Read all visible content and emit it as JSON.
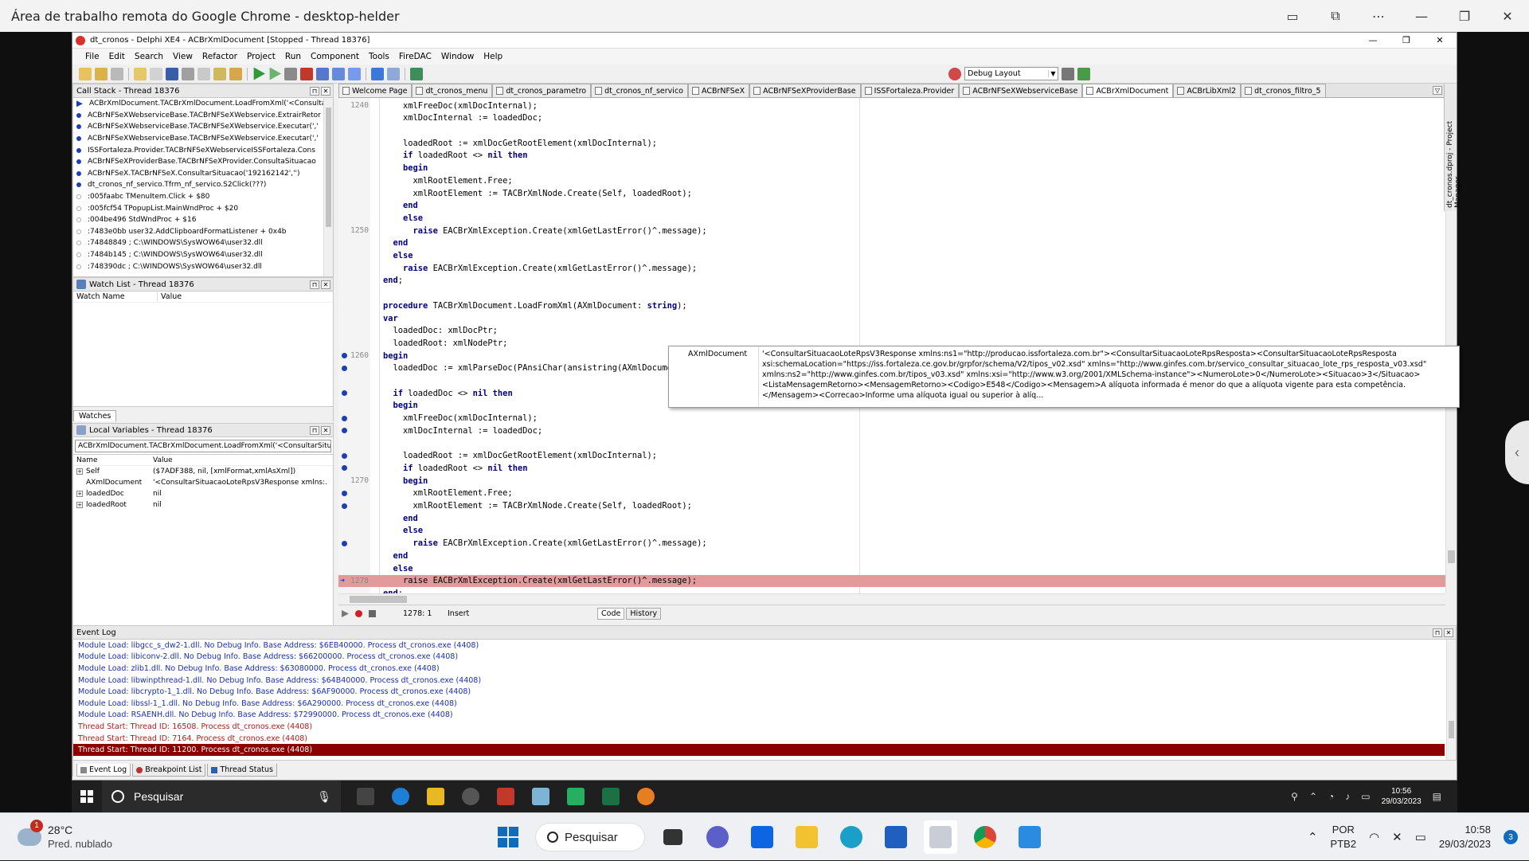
{
  "outer_window": {
    "title": "Área de trabalho remota do Google Chrome - desktop-helder",
    "controls": [
      "▭",
      "⧉",
      "⋯",
      "—",
      "❐",
      "✕"
    ]
  },
  "ide": {
    "title": "dt_cronos - Delphi XE4 - ACBrXmlDocument [Stopped - Thread 18376]",
    "menu": [
      "File",
      "Edit",
      "Search",
      "View",
      "Refactor",
      "Project",
      "Run",
      "Component",
      "Tools",
      "FireDAC",
      "Window",
      "Help"
    ],
    "layout_select": "Debug Layout",
    "colors": {
      "accent": "#1d3fb0",
      "execution_line": "#e39a9a",
      "selected_log": "#8b0000"
    }
  },
  "call_stack": {
    "title": "Call Stack - Thread 18376",
    "rows": [
      {
        "text": "ACBrXmlDocument.TACBrXmlDocument.LoadFromXml('<ConsultarS",
        "marker": "arrow"
      },
      {
        "text": "ACBrNFSeXWebserviceBase.TACBrNFSeXWebservice.ExtrairRetor",
        "marker": "blue"
      },
      {
        "text": "ACBrNFSeXWebserviceBase.TACBrNFSeXWebservice.Executar(','",
        "marker": "blue"
      },
      {
        "text": "ACBrNFSeXWebserviceBase.TACBrNFSeXWebservice.Executar(','",
        "marker": "blue"
      },
      {
        "text": "ISSFortaleza.Provider.TACBrNFSeXWebserviceISSFortaleza.Cons",
        "marker": "blue"
      },
      {
        "text": "ACBrNFSeXProviderBase.TACBrNFSeXProvider.ConsultaSituacao",
        "marker": "blue"
      },
      {
        "text": "ACBrNFSeX.TACBrNFSeX.ConsultarSituacao('192162142','')",
        "marker": "blue"
      },
      {
        "text": "dt_cronos_nf_servico.Tfrm_nf_servico.S2Click(???)",
        "marker": "blue"
      },
      {
        "text": ":005faabc TMenuItem.Click + $80",
        "marker": "grey"
      },
      {
        "text": ":005fcf54 TPopupList.MainWndProc + $20",
        "marker": "grey"
      },
      {
        "text": ":004be496 StdWndProc + $16",
        "marker": "grey"
      },
      {
        "text": ":7483e0bb user32.AddClipboardFormatListener + 0x4b",
        "marker": "grey"
      },
      {
        "text": ":74848849 ; C:\\WINDOWS\\SysWOW64\\user32.dll",
        "marker": "grey"
      },
      {
        "text": ":7484b145 ; C:\\WINDOWS\\SysWOW64\\user32.dll",
        "marker": "grey"
      },
      {
        "text": ":748390dc ; C:\\WINDOWS\\SysWOW64\\user32.dll",
        "marker": "grey"
      }
    ]
  },
  "watch_list": {
    "title": "Watch List - Thread 18376",
    "col_name": "Watch Name",
    "col_value": "Value",
    "tab": "Watches"
  },
  "local_variables": {
    "title": "Local Variables - Thread 18376",
    "scope": "ACBrXmlDocument.TACBrXmlDocument.LoadFromXml('<ConsultarSitu",
    "col_name": "Name",
    "col_value": "Value",
    "rows": [
      {
        "name": "Self",
        "value": "($7ADF388, nil, [xmlFormat,xmlAsXml])",
        "expand": "+"
      },
      {
        "name": "AXmlDocument",
        "value": "'<ConsultarSituacaoLoteRpsV3Response xmlns:...",
        "expand": ""
      },
      {
        "name": "loadedDoc",
        "value": "nil",
        "expand": "+"
      },
      {
        "name": "loadedRoot",
        "value": "nil",
        "expand": "+"
      }
    ]
  },
  "editor_tabs": [
    {
      "label": "Welcome Page",
      "active": false
    },
    {
      "label": "dt_cronos_menu",
      "active": false
    },
    {
      "label": "dt_cronos_parametro",
      "active": false
    },
    {
      "label": "dt_cronos_nf_servico",
      "active": false
    },
    {
      "label": "ACBrNFSeX",
      "active": false
    },
    {
      "label": "ACBrNFSeXProviderBase",
      "active": false
    },
    {
      "label": "ISSFortaleza.Provider",
      "active": false
    },
    {
      "label": "ACBrNFSeXWebserviceBase",
      "active": false
    },
    {
      "label": "ACBrXmlDocument",
      "active": true
    },
    {
      "label": "ACBrLibXml2",
      "active": false
    },
    {
      "label": "dt_cronos_filtro_5",
      "active": false
    }
  ],
  "code_lines": [
    {
      "num": "1240",
      "text": "    xmlFreeDoc(xmlDocInternal);",
      "bp": false,
      "exec": false
    },
    {
      "num": "",
      "text": "    xmlDocInternal := loadedDoc;",
      "bp": false,
      "exec": false
    },
    {
      "num": "",
      "text": "",
      "bp": false,
      "exec": false
    },
    {
      "num": "",
      "text": "    loadedRoot := xmlDocGetRootElement(xmlDocInternal);",
      "bp": false,
      "exec": false
    },
    {
      "num": "",
      "text": "    if loadedRoot <> nil then",
      "bp": false,
      "exec": false
    },
    {
      "num": "",
      "text": "    begin",
      "bp": false,
      "exec": false
    },
    {
      "num": "",
      "text": "      xmlRootElement.Free;",
      "bp": false,
      "exec": false
    },
    {
      "num": "",
      "text": "      xmlRootElement := TACBrXmlNode.Create(Self, loadedRoot);",
      "bp": false,
      "exec": false
    },
    {
      "num": "",
      "text": "    end",
      "bp": false,
      "exec": false
    },
    {
      "num": "",
      "text": "    else",
      "bp": false,
      "exec": false
    },
    {
      "num": "1250",
      "text": "      raise EACBrXmlException.Create(xmlGetLastError()^.message);",
      "bp": false,
      "exec": false
    },
    {
      "num": "",
      "text": "  end",
      "bp": false,
      "exec": false
    },
    {
      "num": "",
      "text": "  else",
      "bp": false,
      "exec": false
    },
    {
      "num": "",
      "text": "    raise EACBrXmlException.Create(xmlGetLastError()^.message);",
      "bp": false,
      "exec": false
    },
    {
      "num": "",
      "text": "end;",
      "bp": false,
      "exec": false
    },
    {
      "num": "",
      "text": "",
      "bp": false,
      "exec": false
    },
    {
      "num": "",
      "text": "procedure TACBrXmlDocument.LoadFromXml(AXmlDocument: string);",
      "bp": false,
      "exec": false
    },
    {
      "num": "",
      "text": "var",
      "bp": false,
      "exec": false
    },
    {
      "num": "",
      "text": "  loadedDoc: xmlDocPtr;",
      "bp": false,
      "exec": false
    },
    {
      "num": "",
      "text": "  loadedRoot: xmlNodePtr;",
      "bp": false,
      "exec": false
    },
    {
      "num": "1260",
      "text": "begin",
      "bp": true,
      "exec": false
    },
    {
      "num": "",
      "text": "  loadedDoc := xmlParseDoc(PAnsiChar(ansistring(AXmlDocument)));",
      "bp": true,
      "exec": false
    },
    {
      "num": "",
      "text": "",
      "bp": false,
      "exec": false
    },
    {
      "num": "",
      "text": "  if loadedDoc <> nil then",
      "bp": true,
      "exec": false
    },
    {
      "num": "",
      "text": "  begin",
      "bp": false,
      "exec": false
    },
    {
      "num": "",
      "text": "    xmlFreeDoc(xmlDocInternal);",
      "bp": true,
      "exec": false
    },
    {
      "num": "",
      "text": "    xmlDocInternal := loadedDoc;",
      "bp": true,
      "exec": false
    },
    {
      "num": "",
      "text": "",
      "bp": false,
      "exec": false
    },
    {
      "num": "",
      "text": "    loadedRoot := xmlDocGetRootElement(xmlDocInternal);",
      "bp": true,
      "exec": false
    },
    {
      "num": "",
      "text": "    if loadedRoot <> nil then",
      "bp": true,
      "exec": false
    },
    {
      "num": "1270",
      "text": "    begin",
      "bp": false,
      "exec": false
    },
    {
      "num": "",
      "text": "      xmlRootElement.Free;",
      "bp": true,
      "exec": false
    },
    {
      "num": "",
      "text": "      xmlRootElement := TACBrXmlNode.Create(Self, loadedRoot);",
      "bp": true,
      "exec": false
    },
    {
      "num": "",
      "text": "    end",
      "bp": false,
      "exec": false
    },
    {
      "num": "",
      "text": "    else",
      "bp": false,
      "exec": false
    },
    {
      "num": "",
      "text": "      raise EACBrXmlException.Create(xmlGetLastError()^.message);",
      "bp": true,
      "exec": false
    },
    {
      "num": "",
      "text": "  end",
      "bp": false,
      "exec": false
    },
    {
      "num": "",
      "text": "  else",
      "bp": false,
      "exec": false
    },
    {
      "num": "1278",
      "text": "    raise EACBrXmlException.Create(xmlGetLastError()^.message);",
      "bp": false,
      "exec": true
    },
    {
      "num": "",
      "text": "end;",
      "bp": false,
      "exec": false
    }
  ],
  "hint": {
    "key": "AXmlDocument",
    "value": "'<ConsultarSituacaoLoteRpsV3Response xmlns:ns1=\"http://producao.issfortaleza.com.br\"><ConsultarSituacaoLoteRpsResposta><ConsultarSituacaoLoteRpsResposta xsi:schemaLocation=\"https://iss.fortaleza.ce.gov.br/grpfor/schema/V2/tipos_v02.xsd\" xmlns=\"http://www.ginfes.com.br/servico_consultar_situacao_lote_rps_resposta_v03.xsd\" xmlns:ns2=\"http://www.ginfes.com.br/tipos_v03.xsd\" xmlns:xsi=\"http://www.w3.org/2001/XMLSchema-instance\"><NumeroLote>0</NumeroLote><Situacao>3</Situacao><ListaMensagemRetorno><MensagemRetorno><Codigo>E548</Codigo><Mensagem>A alíquota informada é menor do que a alíquota vigente para esta competência.</Mensagem><Correcao>Informe uma alíquota igual ou superior à alíq..."
  },
  "editor_status": {
    "position": "1278:  1",
    "mode": "Insert",
    "tab_code": "Code",
    "tab_history": "History"
  },
  "project_manager": "dt_cronos.dproj - Project Manager",
  "event_log": {
    "title": "Event Log",
    "rows": [
      {
        "text": "Module Load: libgcc_s_dw2-1.dll. No Debug Info. Base Address: $6EB40000. Process dt_cronos.exe (4408)",
        "kind": "blue"
      },
      {
        "text": "Module Load: libiconv-2.dll. No Debug Info. Base Address: $66200000. Process dt_cronos.exe (4408)",
        "kind": "blue"
      },
      {
        "text": "Module Load: zlib1.dll. No Debug Info. Base Address: $63080000. Process dt_cronos.exe (4408)",
        "kind": "blue"
      },
      {
        "text": "Module Load: libwinpthread-1.dll. No Debug Info. Base Address: $64B40000. Process dt_cronos.exe (4408)",
        "kind": "blue"
      },
      {
        "text": "Module Load: libcrypto-1_1.dll. No Debug Info. Base Address: $6AF90000. Process dt_cronos.exe (4408)",
        "kind": "blue"
      },
      {
        "text": "Module Load: libssl-1_1.dll. No Debug Info. Base Address: $6A290000. Process dt_cronos.exe (4408)",
        "kind": "blue"
      },
      {
        "text": "Module Load: RSAENH.dll. No Debug Info. Base Address: $72990000. Process dt_cronos.exe (4408)",
        "kind": "blue"
      },
      {
        "text": "Thread Start: Thread ID: 16508. Process dt_cronos.exe (4408)",
        "kind": "red"
      },
      {
        "text": "Thread Start: Thread ID: 7164. Process dt_cronos.exe (4408)",
        "kind": "red"
      },
      {
        "text": "Thread Start: Thread ID: 11200. Process dt_cronos.exe (4408)",
        "kind": "sel"
      }
    ],
    "tabs": [
      "Event Log",
      "Breakpoint List",
      "Thread Status"
    ]
  },
  "remote_taskbar": {
    "search": "Pesquisar",
    "time": "10:56",
    "date": "29/03/2023"
  },
  "taskbar": {
    "weather_temp": "28°C",
    "weather_desc": "Pred. nublado",
    "weather_badge": "1",
    "search": "Pesquisar",
    "lang_1": "POR",
    "lang_2": "PTB2",
    "time": "10:58",
    "date": "29/03/2023",
    "notif": "3"
  }
}
